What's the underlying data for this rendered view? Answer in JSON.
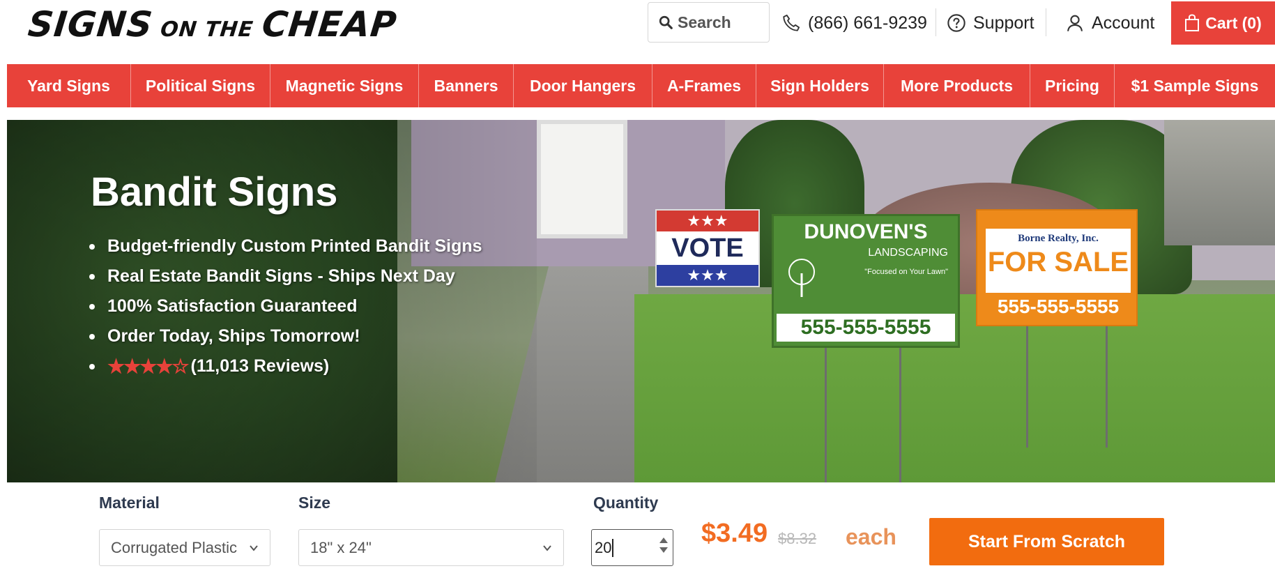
{
  "header": {
    "logo": {
      "part1": "SIGNS",
      "part2": "ON THE",
      "part3": "CHEAP"
    },
    "search": {
      "placeholder": "Search"
    },
    "phone": "(866) 661-9239",
    "support": "Support",
    "account": "Account",
    "cart": "Cart (0)"
  },
  "nav": {
    "items": [
      "Yard Signs",
      "Political Signs",
      "Magnetic Signs",
      "Banners",
      "Door Hangers",
      "A-Frames",
      "Sign Holders",
      "More Products",
      "Pricing",
      "$1 Sample Signs"
    ]
  },
  "hero": {
    "title": "Bandit Signs",
    "bullets": [
      "Budget-friendly Custom Printed Bandit Signs",
      "Real Estate Bandit Signs - Ships Next Day",
      "100% Satisfaction Guaranteed",
      "Order Today, Ships Tomorrow!"
    ],
    "rating": {
      "stars": 4.5,
      "reviews": "(11,013 Reviews)"
    },
    "signs": {
      "vote": "VOTE",
      "landscaping_name": "DUNOVEN'S",
      "landscaping_sub": "LANDSCAPING",
      "landscaping_tag": "\"Focused on Your Lawn\"",
      "landscaping_phone": "555-555-5555",
      "realty_name": "Borne Realty, Inc.",
      "realty_sale": "FOR SALE",
      "realty_phone": "555-555-5555"
    }
  },
  "config": {
    "material_label": "Material",
    "material_value": "Corrugated Plastic",
    "size_label": "Size",
    "size_value": "18\" x 24\"",
    "quantity_label": "Quantity",
    "quantity_value": "20",
    "price": "$3.49",
    "old_price": "$8.32",
    "each": "each",
    "cta": "Start From Scratch"
  },
  "colors": {
    "brand_red": "#e8423a",
    "cta_orange": "#f26c0f",
    "price_orange": "#f26c22"
  }
}
